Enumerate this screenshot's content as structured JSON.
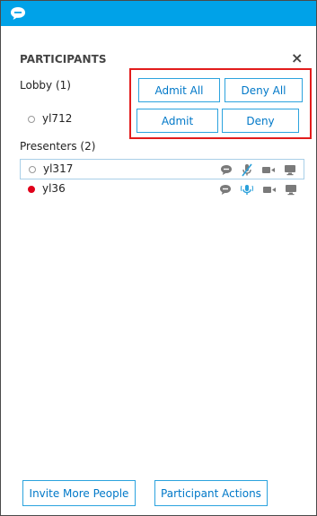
{
  "app": {
    "logo_icon": "chat-bubble-icon",
    "accent": "#00a2e8"
  },
  "panel": {
    "title": "PARTICIPANTS",
    "close_icon": "close-icon",
    "lobby": {
      "label": "Lobby (1)",
      "participants": [
        {
          "name": "yl712",
          "status": "offline"
        }
      ],
      "buttons": {
        "admit_all": "Admit All",
        "deny_all": "Deny All",
        "admit": "Admit",
        "deny": "Deny"
      }
    },
    "presenters": {
      "label": "Presenters (2)",
      "participants": [
        {
          "name": "yl317",
          "status": "offline",
          "selected": true,
          "icons": [
            "im-icon",
            "muted-mic-icon",
            "video-icon",
            "screen-share-icon"
          ]
        },
        {
          "name": "yl36",
          "status": "busy",
          "selected": false,
          "icons": [
            "im-icon",
            "active-mic-icon",
            "video-icon",
            "screen-share-icon"
          ]
        }
      ]
    },
    "footer": {
      "invite_label": "Invite More People",
      "actions_label": "Participant Actions"
    },
    "highlight_color": "#e21c1c"
  }
}
